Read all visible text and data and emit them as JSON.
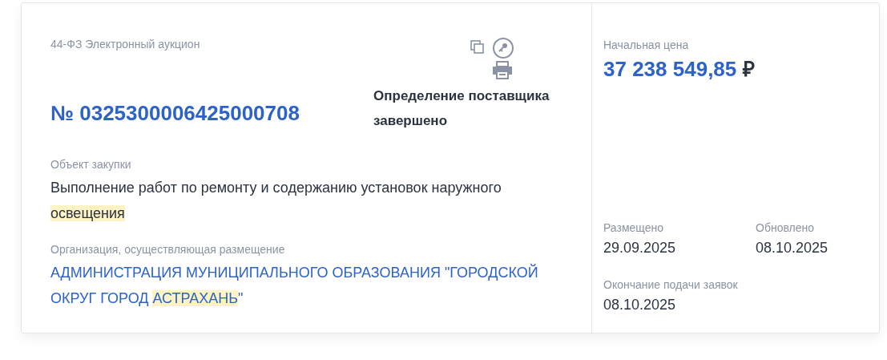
{
  "procurement": {
    "type": "44-ФЗ Электронный аукцион",
    "number": "№ 0325300006425000708",
    "status": "Определение поставщика завершено"
  },
  "object": {
    "label": "Объект закупки",
    "segments": [
      {
        "text": "Выполнение работ по ремонту и содержанию установок наружного ",
        "highlighted": false
      },
      {
        "text": "освещения",
        "highlighted": true
      }
    ]
  },
  "organization": {
    "label": "Организация, осуществляющая размещение",
    "segments": [
      {
        "text": "АДМИНИСТРАЦИЯ МУНИЦИПАЛЬНОГО ОБРАЗОВАНИЯ \"ГОРОДСКОЙ ОКРУГ ГОРОД ",
        "highlighted": false
      },
      {
        "text": "АСТРАХАНЬ",
        "highlighted": true
      },
      {
        "text": "\"",
        "highlighted": false
      }
    ]
  },
  "price": {
    "label": "Начальная цена",
    "value": "37 238 549,85",
    "currency": "₽"
  },
  "dates": [
    {
      "label": "Размещено",
      "value": "29.09.2025"
    },
    {
      "label": "Обновлено",
      "value": "08.10.2025"
    },
    {
      "label": "Окончание подачи заявок",
      "value": "08.10.2025"
    }
  ]
}
